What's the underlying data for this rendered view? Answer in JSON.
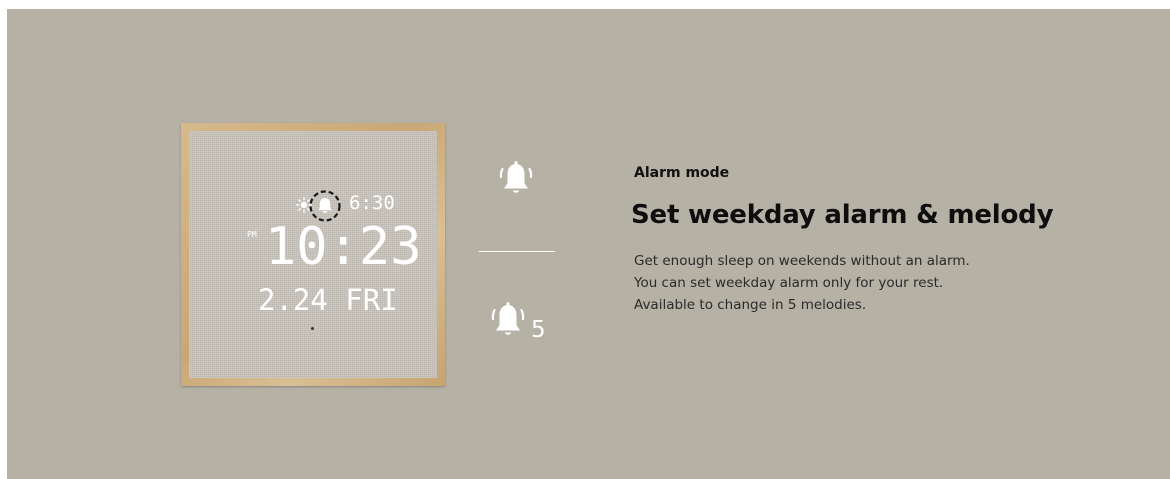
{
  "clock": {
    "alarm_time": "6:30",
    "pm_label": "PM",
    "time": "10:23",
    "date": "2.24 FRI"
  },
  "icons": {
    "top": "alarm-bell-ringing-icon",
    "bottom": "alarm-bell-melody-icon",
    "melody_count": "5"
  },
  "content": {
    "eyebrow": "Alarm mode",
    "headline": "Set weekday alarm & melody",
    "lines": [
      "Get enough sleep on weekends without an alarm.",
      "You can set weekday alarm only for your rest.",
      "Available to change in 5 melodies."
    ]
  },
  "colors": {
    "panel_bg": "#b6b1a5",
    "frame_wood": "#caa775",
    "clock_face": "#c9c4bb",
    "display_white": "#ffffff"
  }
}
